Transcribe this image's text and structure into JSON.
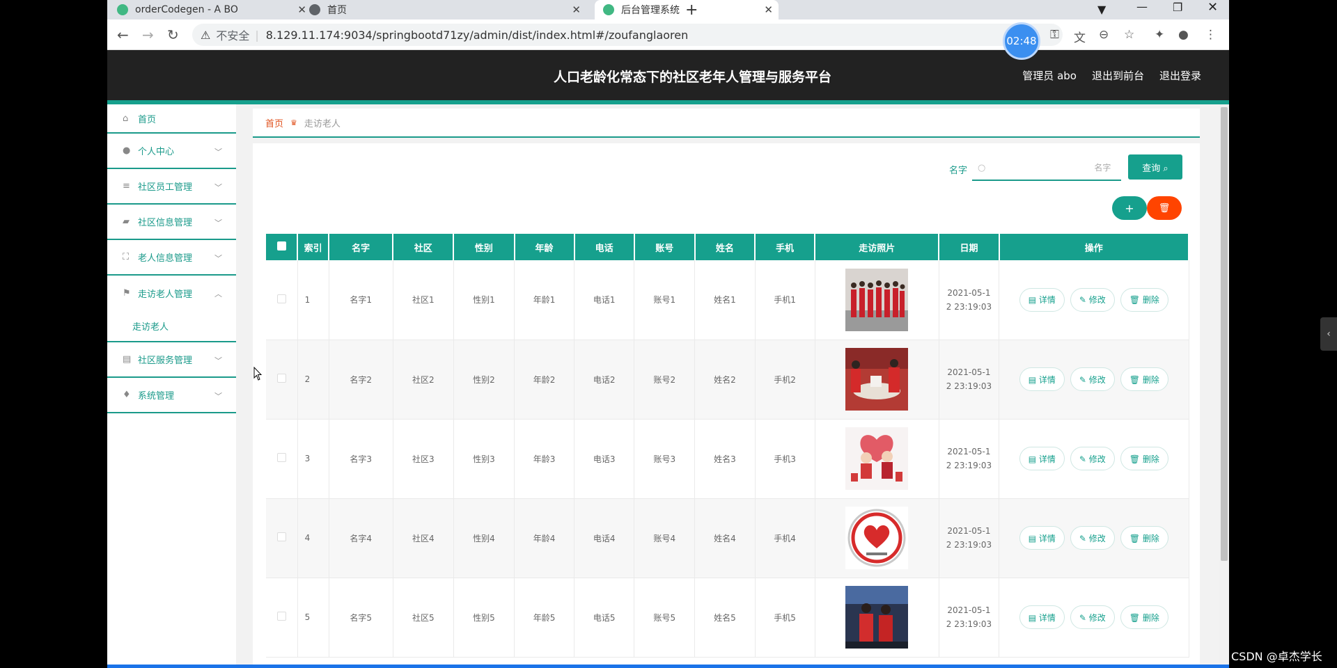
{
  "browser": {
    "tabs": [
      {
        "title": "orderCodegen - A BO",
        "favicon_color": "#41b883"
      },
      {
        "title": "首页",
        "favicon_color": "#5f6368"
      },
      {
        "title": "后台管理系统",
        "favicon_color": "#41b883"
      }
    ],
    "not_secure": "不安全",
    "url": "8.129.11.174:9034/springbootd71zy/admin/dist/index.html#/zoufanglaoren",
    "timer": "02:48"
  },
  "header": {
    "title": "人口老龄化常态下的社区老年人管理与服务平台",
    "admin": "管理员 abo",
    "to_front": "退出到前台",
    "logout": "退出登录"
  },
  "sidebar": {
    "items": [
      {
        "label": "首页",
        "icon": "home-icon"
      },
      {
        "label": "个人中心",
        "icon": "user-icon"
      },
      {
        "label": "社区员工管理",
        "icon": "list-icon"
      },
      {
        "label": "社区信息管理",
        "icon": "briefcase-icon"
      },
      {
        "label": "老人信息管理",
        "icon": "frame-icon"
      },
      {
        "label": "走访老人管理",
        "icon": "flag-icon"
      },
      {
        "label": "社区服务管理",
        "icon": "clipboard-icon"
      },
      {
        "label": "系统管理",
        "icon": "mic-icon"
      }
    ],
    "sub_item": "走访老人"
  },
  "breadcrumb": {
    "home": "首页",
    "current": "走访老人"
  },
  "search": {
    "label": "名字",
    "placeholder": "名字",
    "button": "查询"
  },
  "table": {
    "headers": [
      "索引",
      "名字",
      "社区",
      "性别",
      "年龄",
      "电话",
      "账号",
      "姓名",
      "手机",
      "走访照片",
      "日期",
      "操作"
    ],
    "rows": [
      {
        "idx": "1",
        "name": "名字1",
        "community": "社区1",
        "gender": "性别1",
        "age": "年龄1",
        "phone": "电话1",
        "account": "账号1",
        "realname": "姓名1",
        "mobile": "手机1",
        "date1": "2021-05-1",
        "date2": "2 23:19:03"
      },
      {
        "idx": "2",
        "name": "名字2",
        "community": "社区2",
        "gender": "性别2",
        "age": "年龄2",
        "phone": "电话2",
        "account": "账号2",
        "realname": "姓名2",
        "mobile": "手机2",
        "date1": "2021-05-1",
        "date2": "2 23:19:03"
      },
      {
        "idx": "3",
        "name": "名字3",
        "community": "社区3",
        "gender": "性别3",
        "age": "年龄3",
        "phone": "电话3",
        "account": "账号3",
        "realname": "姓名3",
        "mobile": "手机3",
        "date1": "2021-05-1",
        "date2": "2 23:19:03"
      },
      {
        "idx": "4",
        "name": "名字4",
        "community": "社区4",
        "gender": "性别4",
        "age": "年龄4",
        "phone": "电话4",
        "account": "账号4",
        "realname": "姓名4",
        "mobile": "手机4",
        "date1": "2021-05-1",
        "date2": "2 23:19:03"
      },
      {
        "idx": "5",
        "name": "名字5",
        "community": "社区5",
        "gender": "性别5",
        "age": "年龄5",
        "phone": "电话5",
        "account": "账号5",
        "realname": "姓名5",
        "mobile": "手机5",
        "date1": "2021-05-1",
        "date2": "2 23:19:03"
      }
    ],
    "actions": {
      "detail": "详情",
      "edit": "修改",
      "delete": "删除"
    }
  },
  "watermark": "CSDN @卓杰学长",
  "colors": {
    "accent": "#16a08d",
    "danger": "#ff4400",
    "header_bg": "#222222"
  }
}
